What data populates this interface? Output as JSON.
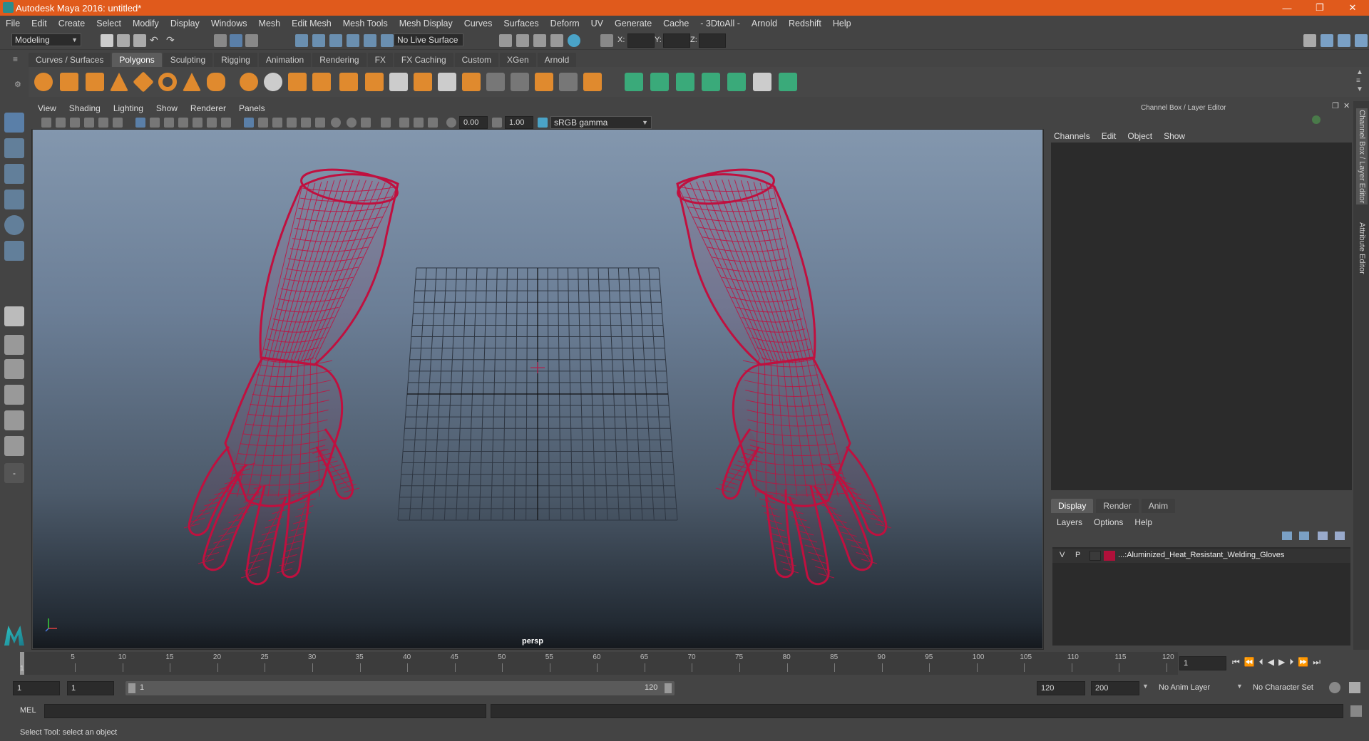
{
  "window": {
    "title": "Autodesk Maya 2016: untitled*",
    "controls": [
      "—",
      "❐",
      "✕"
    ]
  },
  "menubar": [
    "File",
    "Edit",
    "Create",
    "Select",
    "Modify",
    "Display",
    "Windows",
    "Mesh",
    "Edit Mesh",
    "Mesh Tools",
    "Mesh Display",
    "Curves",
    "Surfaces",
    "Deform",
    "UV",
    "Generate",
    "Cache",
    "- 3DtoAll -",
    "Arnold",
    "Redshift",
    "Help"
  ],
  "status": {
    "mode": "Modeling",
    "live_surface": "No Live Surface",
    "x_label": "X:",
    "y_label": "Y:",
    "z_label": "Z:"
  },
  "shelf_tabs": [
    "Curves / Surfaces",
    "Polygons",
    "Sculpting",
    "Rigging",
    "Animation",
    "Rendering",
    "FX",
    "FX Caching",
    "Custom",
    "XGen",
    "Arnold"
  ],
  "shelf_active": "Polygons",
  "viewport": {
    "menu": [
      "View",
      "Shading",
      "Lighting",
      "Show",
      "Renderer",
      "Panels"
    ],
    "exposure": "0.00",
    "gamma": "1.00",
    "color_space": "sRGB gamma",
    "camera": "persp",
    "wire_color": "#c0103f"
  },
  "channel_box": {
    "title": "Channel Box / Layer Editor",
    "menu": [
      "Channels",
      "Edit",
      "Object",
      "Show"
    ]
  },
  "layer_editor": {
    "tabs": [
      "Display",
      "Render",
      "Anim"
    ],
    "active_tab": "Display",
    "menu": [
      "Layers",
      "Options",
      "Help"
    ],
    "layers": [
      {
        "v": "V",
        "p": "P",
        "color": "#b0103a",
        "name": "...:Aluminized_Heat_Resistant_Welding_Gloves"
      }
    ]
  },
  "side_tabs": [
    "Channel Box / Layer Editor",
    "Attribute Editor"
  ],
  "timeline": {
    "ticks": [
      "5",
      "10",
      "15",
      "20",
      "25",
      "30",
      "35",
      "40",
      "45",
      "50",
      "55",
      "60",
      "65",
      "70",
      "75",
      "80",
      "85",
      "90",
      "95",
      "100",
      "105",
      "110",
      "115",
      "120"
    ],
    "start_marker": "1",
    "current_frame": "1"
  },
  "range": {
    "start": "1",
    "playback_start": "1",
    "slider_start": "1",
    "slider_end": "120",
    "playback_end": "120",
    "end": "200",
    "anim_layer": "No Anim Layer",
    "character_set": "No Character Set"
  },
  "command_line": {
    "label": "MEL"
  },
  "help_line": "Select Tool: select an object"
}
